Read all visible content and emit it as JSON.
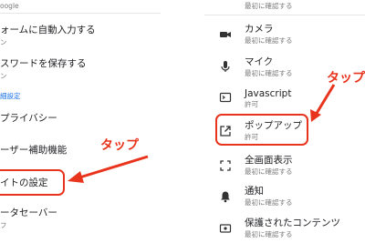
{
  "left": {
    "top_text": "oogle",
    "items": [
      {
        "title": "ォームに自動入力する",
        "sub": "ン"
      },
      {
        "title": "スワードを保存する",
        "sub": "ン"
      }
    ],
    "section_header": "細設定",
    "items2": [
      {
        "title": "プライバシー"
      },
      {
        "title": "ーザー補助機能"
      },
      {
        "title": "イトの設定"
      },
      {
        "title": "ータセーバー",
        "sub": "フ"
      }
    ],
    "tap_label": "タップ"
  },
  "right": {
    "top_sub": "最初に確認する",
    "items": [
      {
        "icon": "camera-icon",
        "title": "カメラ",
        "sub": "最初に確認する"
      },
      {
        "icon": "mic-icon",
        "title": "マイク",
        "sub": "最初に確認する"
      },
      {
        "icon": "javascript-icon",
        "title": "Javascript",
        "sub": "許可"
      },
      {
        "icon": "popup-icon",
        "title": "ポップアップ",
        "sub": "許可"
      },
      {
        "icon": "fullscreen-icon",
        "title": "全画面表示",
        "sub": "最初に確認する"
      },
      {
        "icon": "bell-icon",
        "title": "通知",
        "sub": "最初に確認する"
      },
      {
        "icon": "protected-content-icon",
        "title": "保護されたコンテンツ",
        "sub": "最初に確認する"
      }
    ],
    "tap_label": "タップ"
  },
  "colors": {
    "accent": "#e8341c",
    "link": "#1a73e8",
    "text": "#202124",
    "secondary": "#7a7a7a"
  }
}
